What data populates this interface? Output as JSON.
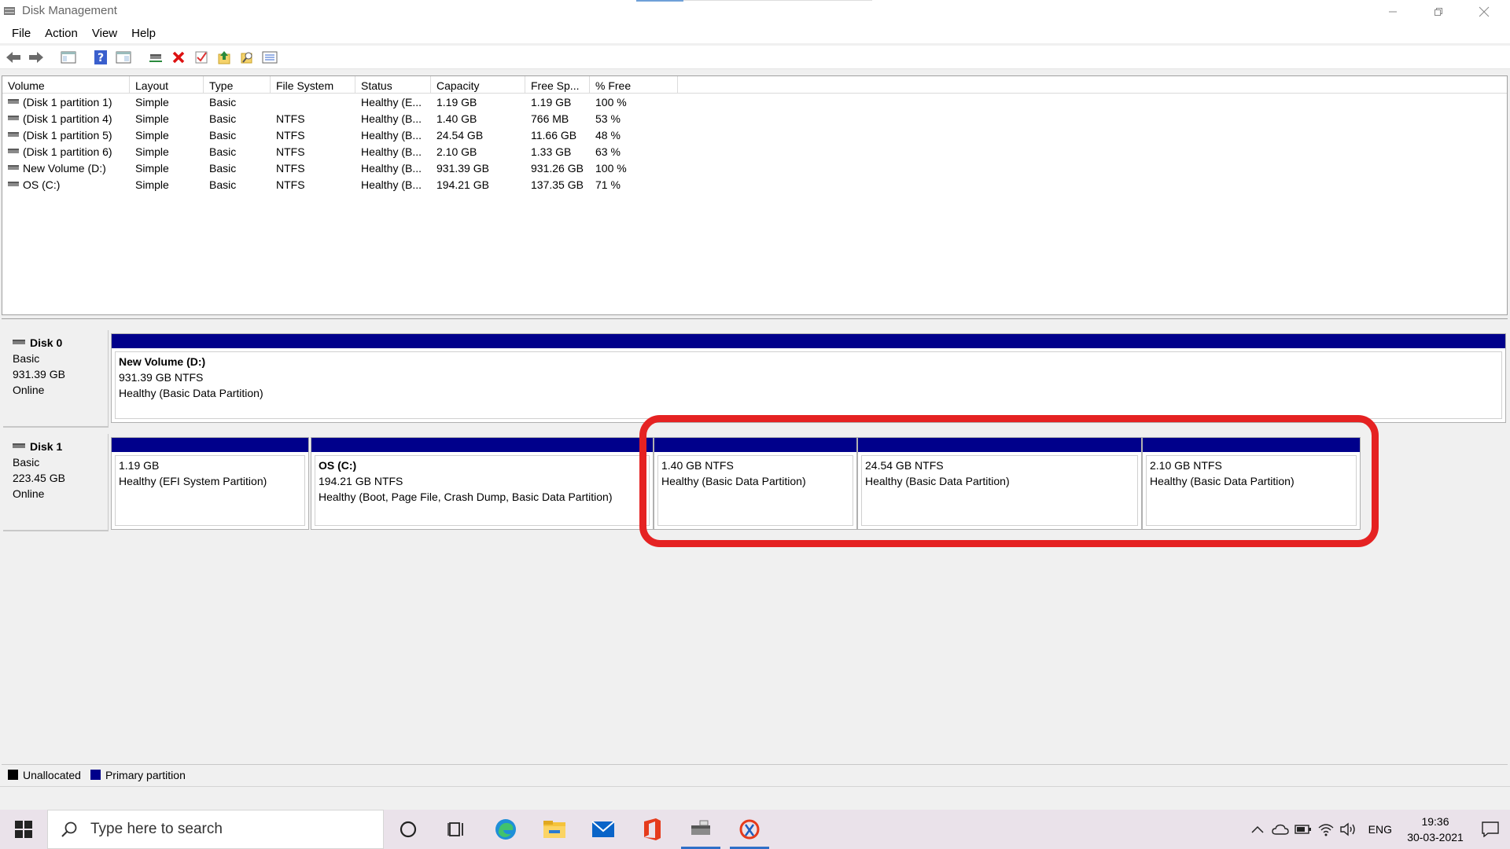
{
  "window": {
    "title": "Disk Management"
  },
  "menu": [
    "File",
    "Action",
    "View",
    "Help"
  ],
  "toolbar": {
    "icons": [
      "back-icon",
      "forward-icon",
      "console-tree-icon",
      "help-icon",
      "properties-icon",
      "connect-icon",
      "delete-icon",
      "check-icon",
      "up-icon",
      "search-folder-icon",
      "list-icon"
    ]
  },
  "volume_list": {
    "columns": [
      "Volume",
      "Layout",
      "Type",
      "File System",
      "Status",
      "Capacity",
      "Free Sp...",
      "% Free"
    ],
    "rows": [
      [
        "(Disk 1 partition 1)",
        "Simple",
        "Basic",
        "",
        "Healthy (E...",
        "1.19 GB",
        "1.19 GB",
        "100 %"
      ],
      [
        "(Disk 1 partition 4)",
        "Simple",
        "Basic",
        "NTFS",
        "Healthy (B...",
        "1.40 GB",
        "766 MB",
        "53 %"
      ],
      [
        "(Disk 1 partition 5)",
        "Simple",
        "Basic",
        "NTFS",
        "Healthy (B...",
        "24.54 GB",
        "11.66 GB",
        "48 %"
      ],
      [
        "(Disk 1 partition 6)",
        "Simple",
        "Basic",
        "NTFS",
        "Healthy (B...",
        "2.10 GB",
        "1.33 GB",
        "63 %"
      ],
      [
        "New Volume (D:)",
        "Simple",
        "Basic",
        "NTFS",
        "Healthy (B...",
        "931.39 GB",
        "931.26 GB",
        "100 %"
      ],
      [
        "OS (C:)",
        "Simple",
        "Basic",
        "NTFS",
        "Healthy (B...",
        "194.21 GB",
        "137.35 GB",
        "71 %"
      ]
    ]
  },
  "disks": [
    {
      "name": "Disk 0",
      "type": "Basic",
      "size": "931.39 GB",
      "status": "Online",
      "partitions": [
        {
          "name": "New Volume  (D:)",
          "size": "931.39 GB NTFS",
          "status": "Healthy (Basic Data Partition)"
        }
      ]
    },
    {
      "name": "Disk 1",
      "type": "Basic",
      "size": "223.45 GB",
      "status": "Online",
      "partitions": [
        {
          "name": "",
          "size": "1.19 GB",
          "status": "Healthy (EFI System Partition)"
        },
        {
          "name": "OS  (C:)",
          "size": "194.21 GB NTFS",
          "status": "Healthy (Boot, Page File, Crash Dump, Basic Data Partition)"
        },
        {
          "name": "",
          "size": "1.40 GB NTFS",
          "status": "Healthy (Basic Data Partition)"
        },
        {
          "name": "",
          "size": "24.54 GB NTFS",
          "status": "Healthy (Basic Data Partition)"
        },
        {
          "name": "",
          "size": "2.10 GB NTFS",
          "status": "Healthy (Basic Data Partition)"
        }
      ]
    }
  ],
  "legend": [
    {
      "label": "Unallocated",
      "color": "#000000"
    },
    {
      "label": "Primary partition",
      "color": "#00008b"
    }
  ],
  "taskbar": {
    "search_placeholder": "Type here to search",
    "apps": [
      "cortana-icon",
      "task-view-icon",
      "edge-icon",
      "file-explorer-icon",
      "mail-icon",
      "office-icon",
      "disk-management-icon",
      "snip-icon"
    ],
    "language": "ENG",
    "time": "19:36",
    "date": "30-03-2021"
  },
  "colors": {
    "primary_partition": "#00008b",
    "highlight": "#e52222"
  }
}
